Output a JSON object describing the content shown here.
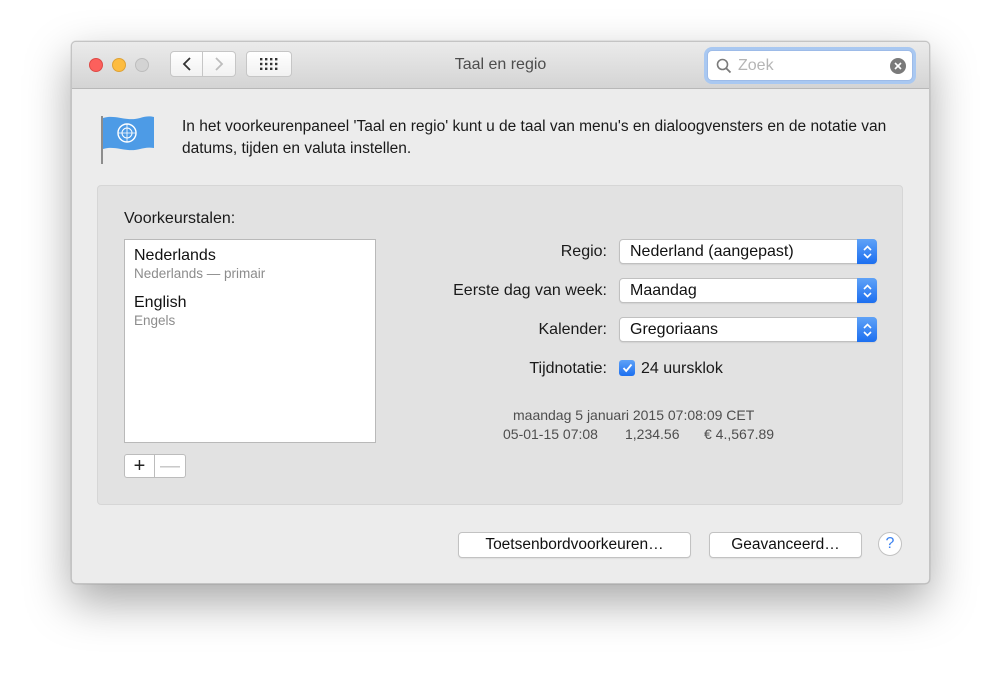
{
  "window": {
    "title": "Taal en regio",
    "search_placeholder": "Zoek",
    "icons": [
      "back-chevron-icon",
      "forward-chevron-icon",
      "grid-icon",
      "search-icon",
      "clear-icon"
    ]
  },
  "intro": {
    "text": "In het voorkeurenpaneel 'Taal en regio' kunt u de taal van menu's en dialoogvensters en de notatie van datums, tijden en valuta instellen.",
    "icon": "un-flag-icon"
  },
  "languages": {
    "label": "Voorkeurstalen:",
    "items": [
      {
        "name": "Nederlands",
        "sub": "Nederlands — primair"
      },
      {
        "name": "English",
        "sub": "Engels"
      }
    ],
    "add": "+",
    "remove": "—"
  },
  "settings": {
    "region": {
      "label": "Regio:",
      "value": "Nederland (aangepast)"
    },
    "first_day": {
      "label": "Eerste dag van week:",
      "value": "Maandag"
    },
    "calendar": {
      "label": "Kalender:",
      "value": "Gregoriaans"
    },
    "time_format": {
      "label": "Tijdnotatie:",
      "checkbox_label": "24 uursklok",
      "checked": true
    }
  },
  "sample": {
    "line1": "maandag 5 januari 2015 07:08:09 CET",
    "date_short": "05-01-15 07:08",
    "number": "1,234.56",
    "currency": "€ 4.,567.89"
  },
  "buttons": {
    "keyboard": "Toetsenbordvoorkeuren…",
    "advanced": "Geavanceerd…",
    "help": "?"
  },
  "colors": {
    "accent": "#1c6ff0",
    "close": "#fc605c",
    "minimize": "#fdbc40",
    "zoom_disabled": "#d3d3d3"
  }
}
